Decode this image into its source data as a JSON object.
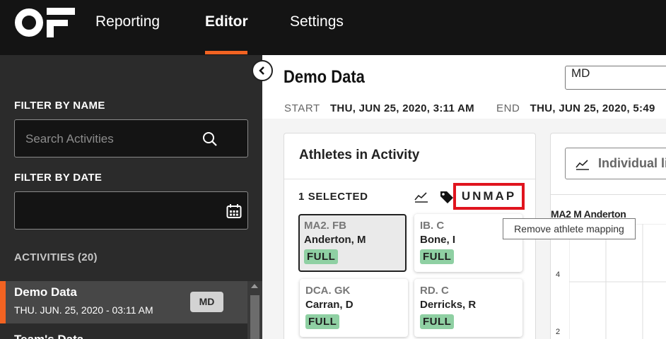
{
  "nav": {
    "logo_icon": "of-logo",
    "tabs": [
      "Reporting",
      "Editor",
      "Settings"
    ],
    "active_tab": "Editor",
    "accent_color": "#f26322"
  },
  "sidebar": {
    "filter_name_label": "FILTER BY NAME",
    "search_placeholder": "Search Activities",
    "filter_date_label": "FILTER BY DATE",
    "activities_label": "ACTIVITIES (20)",
    "activities": [
      {
        "name": "Demo Data",
        "date": "THU. JUN. 25, 2020 - 03:11 AM",
        "badge": "MD",
        "selected": true
      },
      {
        "name": "Team's Data"
      }
    ]
  },
  "main": {
    "title": "Demo Data",
    "tag_value": "MD",
    "start_label": "START",
    "start_value": "THU, JUN 25, 2020, 3:11 AM",
    "end_label": "END",
    "end_value": "THU, JUN 25, 2020, 5:49"
  },
  "athletes_panel": {
    "title": "Athletes in Activity",
    "selected_count": "1 SELECTED",
    "unmap_label": "UNMAP",
    "unmap_highlight_color": "#e0141e",
    "cards": [
      {
        "position": "MA2. FB",
        "name": "Anderton, M",
        "status": "FULL",
        "selected": true
      },
      {
        "position": "IB. C",
        "name": "Bone, I",
        "status": "FULL",
        "selected": false
      },
      {
        "position": "DCA. GK",
        "name": "Carran, D",
        "status": "FULL",
        "selected": false
      },
      {
        "position": "RD. C",
        "name": "Derricks, R",
        "status": "FULL",
        "selected": false
      }
    ],
    "status_color": "#8fd0a3"
  },
  "chart_panel": {
    "view_button_label": "Individual li",
    "athlete_label": "MA2 M Anderton",
    "tick_labels": [
      "4",
      "2"
    ]
  },
  "tooltip": {
    "text": "Remove athlete mapping"
  }
}
